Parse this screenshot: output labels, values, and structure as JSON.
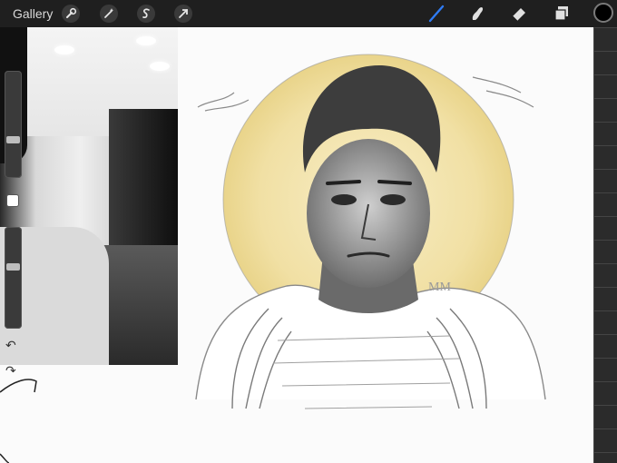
{
  "topbar": {
    "gallery_label": "Gallery",
    "left_tools": [
      "wrench-icon",
      "magic-wand-icon",
      "selection-icon",
      "transform-arrow-icon"
    ],
    "right_tools": [
      "brush-icon",
      "smudge-icon",
      "eraser-icon",
      "layers-icon"
    ],
    "active_tool": "brush-icon",
    "accent_color": "#2f7cf6",
    "current_color": "#000000"
  },
  "sidebar": {
    "brush_size_level": 0.35,
    "opacity_level": 0.62
  },
  "canvas": {
    "signature_text": "MM",
    "halo_color": "#f2e3a6"
  }
}
